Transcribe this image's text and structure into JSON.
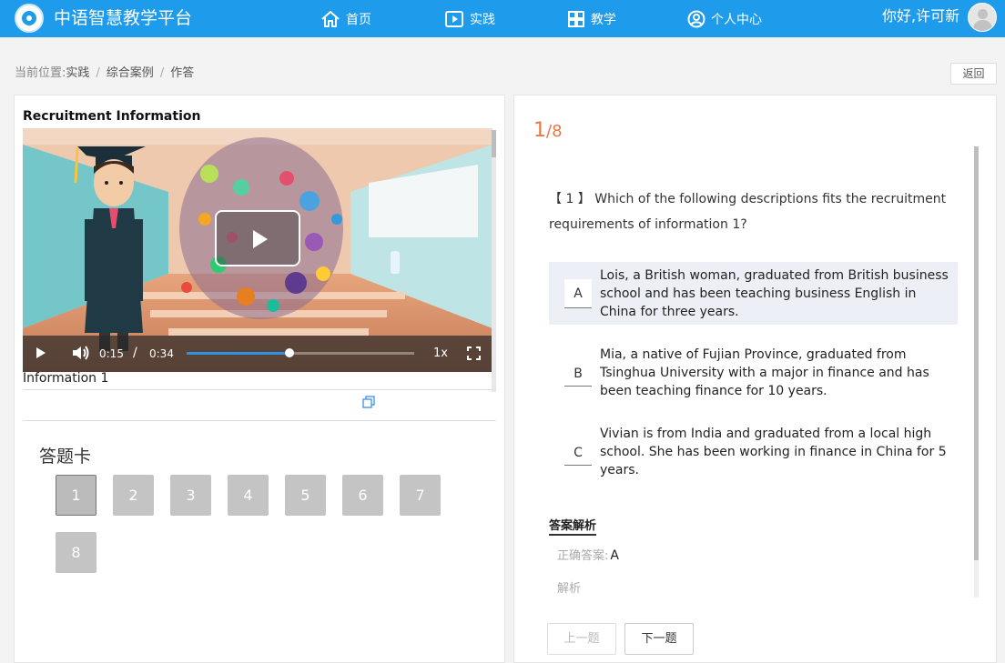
{
  "header": {
    "brand": "中语智慧教学平台",
    "nav": [
      {
        "label": "首页",
        "icon": "home-icon"
      },
      {
        "label": "实践",
        "icon": "play-square-icon"
      },
      {
        "label": "教学",
        "icon": "grid-icon"
      },
      {
        "label": "个人中心",
        "icon": "user-circle-icon"
      }
    ],
    "greeting": "你好,许可新",
    "colors": {
      "bar": "#1e9bea"
    }
  },
  "breadcrumb": {
    "prefix": "当前位置:",
    "items": [
      "实践",
      "综合案例",
      "作答"
    ],
    "separator": "/",
    "back_label": "返回"
  },
  "video": {
    "title": "Recruitment Information",
    "current_time": "0:15",
    "time_separator": "/",
    "duration": "0:34",
    "progress_fraction": 0.45,
    "speed": "1x",
    "caption": "Information 1"
  },
  "answer_card": {
    "title": "答题卡",
    "questions": [
      "1",
      "2",
      "3",
      "4",
      "5",
      "6",
      "7",
      "8"
    ],
    "current": "1"
  },
  "question": {
    "current": "1",
    "total": "/8",
    "text": "【 1 】 Which of the following descriptions fits the recruitment requirements of information 1?",
    "options": [
      {
        "letter": "A",
        "text": "Lois, a British woman, graduated from British business school and has been teaching business English in China for three years.",
        "selected": true
      },
      {
        "letter": "B",
        "text": "Mia, a native of Fujian Province, graduated from Tsinghua University with a major in finance and has been teaching finance for 10 years.",
        "selected": false
      },
      {
        "letter": "C",
        "text": "Vivian is from India and graduated from a local high school. She has been working in finance in China for 5 years.",
        "selected": false
      }
    ],
    "analysis_title": "答案解析",
    "correct_label": "正确答案:",
    "correct_value": "A",
    "explanation_label": "解析",
    "prev_label": "上一题",
    "next_label": "下一题",
    "accent": "#e87645"
  }
}
